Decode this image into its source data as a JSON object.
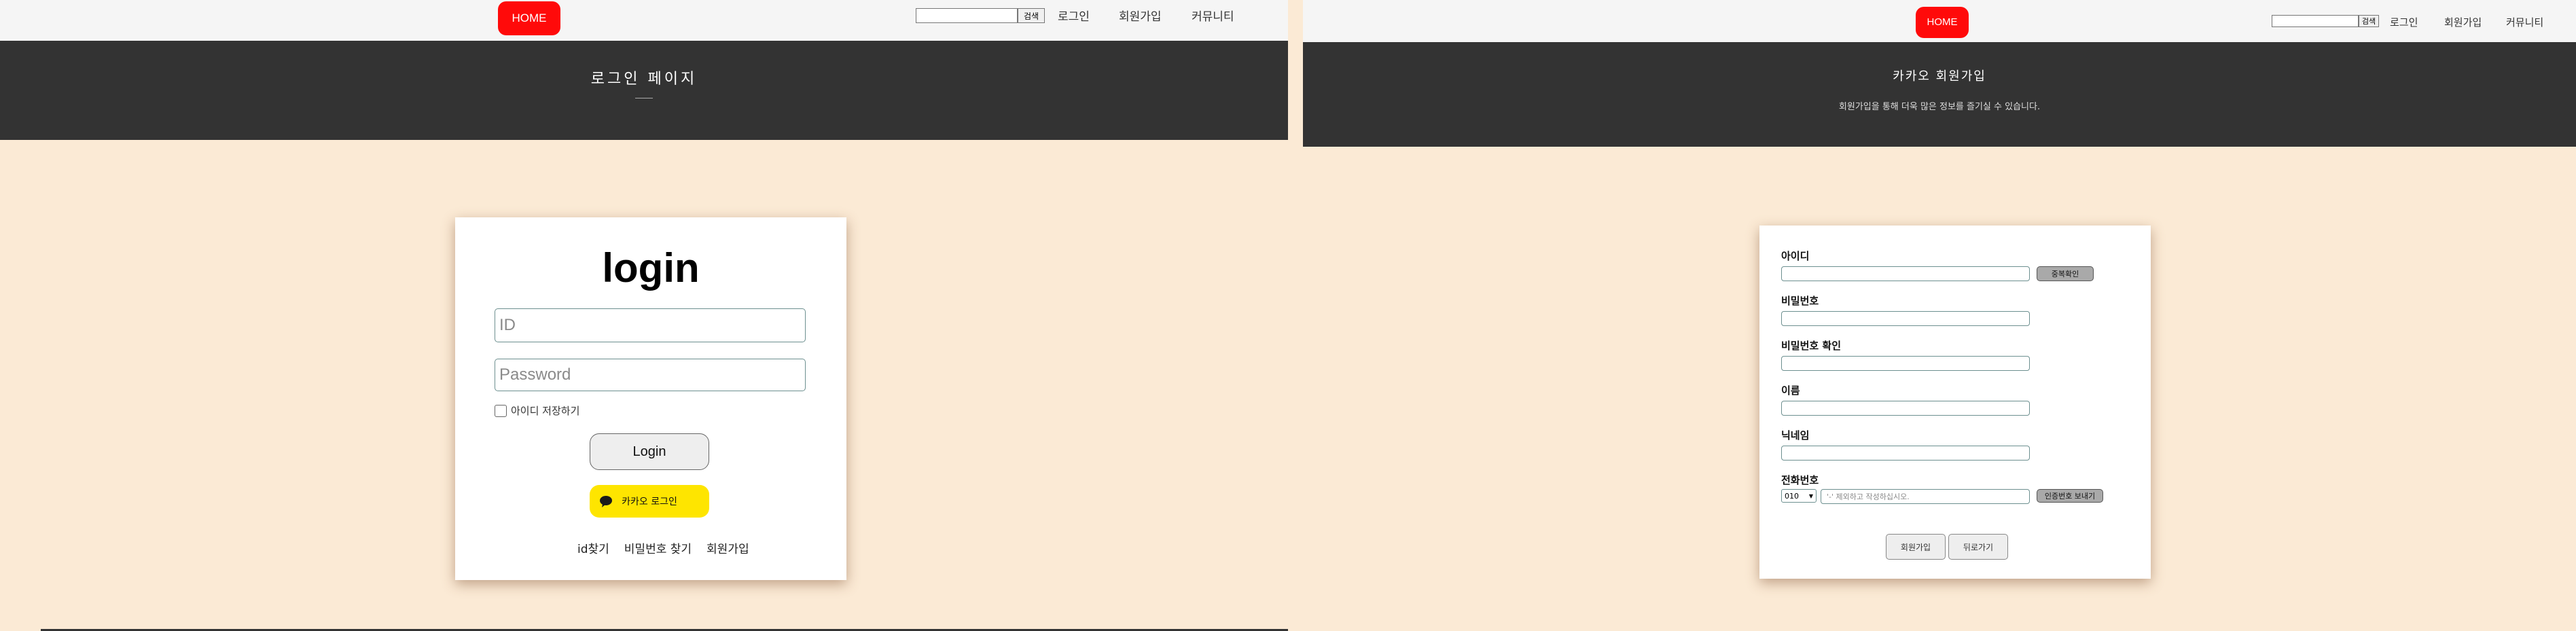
{
  "left": {
    "nav": {
      "home": "HOME",
      "search_button": "검색",
      "links": [
        "로그인",
        "회원가입",
        "커뮤니티"
      ]
    },
    "banner": {
      "title": "로그인 페이지"
    },
    "login": {
      "title": "login",
      "id_placeholder": "ID",
      "password_placeholder": "Password",
      "remember": "아이디 저장하기",
      "login_button": "Login",
      "kakao_button": "카카오 로그인",
      "links": [
        "id찾기",
        "비밀번호 찾기",
        "회원가입"
      ]
    }
  },
  "right": {
    "nav": {
      "home": "HOME",
      "search_button": "검색",
      "links": [
        "로그인",
        "회원가입",
        "커뮤니티"
      ]
    },
    "banner": {
      "title": "카카오 회원가입",
      "subtitle": "회원가입을 통해 더욱 많은 정보를 즐기실 수 있습니다."
    },
    "form": {
      "id_label": "아이디",
      "dup_check": "중복확인",
      "password_label": "비밀번호",
      "password_confirm_label": "비밀번호 확인",
      "name_label": "이름",
      "nickname_label": "닉네임",
      "phone_label": "전화번호",
      "phone_prefix": "010",
      "phone_placeholder": "'-' 제외하고 작성하십시오.",
      "send_code": "인증번호 보내기",
      "signup_button": "회원가입",
      "back_button": "뒤로가기"
    }
  },
  "colors": {
    "home": "#ff0a0a",
    "banner": "#333333",
    "background": "#fbead5",
    "kakao": "#fee500"
  }
}
